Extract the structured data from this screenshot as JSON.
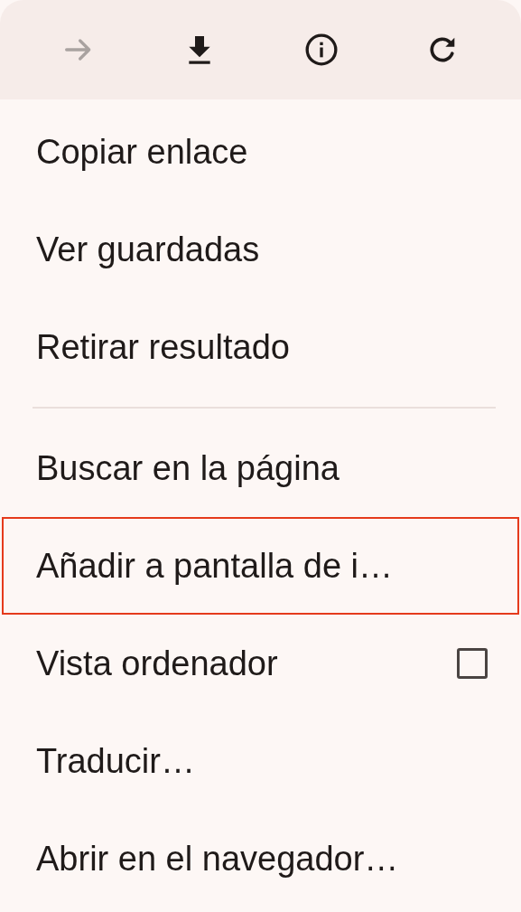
{
  "toolbar": [
    {
      "kind": "forward",
      "disabled": true
    },
    {
      "kind": "download",
      "disabled": false
    },
    {
      "kind": "info",
      "disabled": false
    },
    {
      "kind": "refresh",
      "disabled": false
    }
  ],
  "groups": [
    {
      "items": [
        {
          "kind": "plain",
          "label": "Copiar enlace",
          "highlighted": false
        },
        {
          "kind": "plain",
          "label": "Ver guardadas",
          "highlighted": false
        },
        {
          "kind": "plain",
          "label": "Retirar resultado",
          "highlighted": false
        }
      ]
    },
    {
      "items": [
        {
          "kind": "plain",
          "label": "Buscar en la página",
          "highlighted": false
        },
        {
          "kind": "plain",
          "label": "Añadir a pantalla de i…",
          "highlighted": true
        },
        {
          "kind": "checkbox",
          "label": "Vista ordenador",
          "checked": false,
          "highlighted": false
        },
        {
          "kind": "plain",
          "label": "Traducir…",
          "highlighted": false
        },
        {
          "kind": "plain",
          "label": "Abrir en el navegador…",
          "highlighted": false
        }
      ]
    }
  ]
}
